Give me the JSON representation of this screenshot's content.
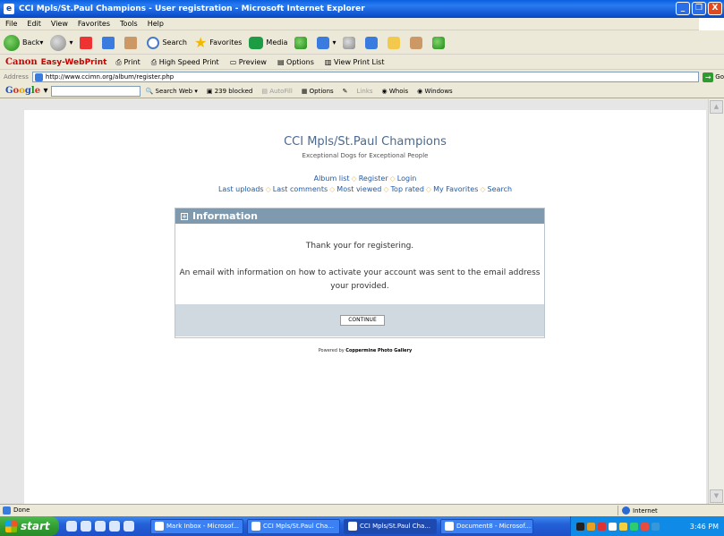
{
  "window": {
    "title": "CCI Mpls/St.Paul Champions - User registration - Microsoft Internet Explorer",
    "buttons": [
      "_",
      "❐",
      "X"
    ]
  },
  "menu": [
    "File",
    "Edit",
    "View",
    "Favorites",
    "Tools",
    "Help"
  ],
  "toolbar": {
    "back": "Back",
    "search": "Search",
    "favorites": "Favorites",
    "media": "Media"
  },
  "canon_bar": {
    "brand": "Canon",
    "product": "Easy-WebPrint",
    "print": "Print",
    "high_speed": "High Speed Print",
    "preview": "Preview",
    "options": "Options",
    "view_list": "View Print List"
  },
  "address": {
    "label": "Address",
    "url": "http://www.ccimn.org/album/register.php",
    "go": "Go"
  },
  "google_bar": {
    "search_web": "Search Web",
    "blocked": "239 blocked",
    "autofill": "AutoFill",
    "options": "Options",
    "links": "Links",
    "whois": "Whois",
    "windows": "Windows"
  },
  "page": {
    "site_title": "CCI Mpls/St.Paul Champions",
    "site_subtitle": "Exceptional Dogs for Exceptional People",
    "nav1": [
      "Album list",
      "Register",
      "Login"
    ],
    "nav2": [
      "Last uploads",
      "Last comments",
      "Most viewed",
      "Top rated",
      "My Favorites",
      "Search"
    ],
    "info_title": "Information",
    "message1": "Thank your for registering.",
    "message2": "An email with information on how to activate your account was sent to the email address your provided.",
    "continue_label": "CONTINUE",
    "powered_prefix": "Powered by",
    "powered_name": "Coppermine Photo Gallery"
  },
  "status": {
    "text": "Done",
    "zone": "Internet"
  },
  "taskbar": {
    "start": "start",
    "tasks": [
      "Mark Inbox - Microsof...",
      "CCI Mpls/St.Paul Cha...",
      "CCI Mpls/St.Paul Cha...",
      "Document8 - Microsof..."
    ],
    "clock": "3:46 PM"
  }
}
